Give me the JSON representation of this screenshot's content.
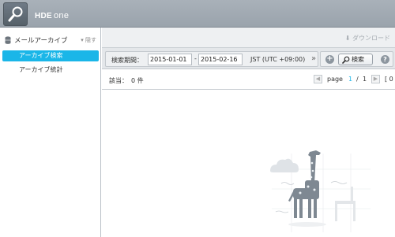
{
  "header": {
    "brand_bold": "HDE",
    "brand_light": "one",
    "logo_icon": "search-icon"
  },
  "sidebar": {
    "section_title": "メールアーカイブ",
    "hide_label": "隠す",
    "items": [
      {
        "label": "アーカイブ検索",
        "active": true
      },
      {
        "label": "アーカイブ統計",
        "active": false
      }
    ]
  },
  "main": {
    "download_label": "ダウンロード",
    "search": {
      "period_label": "検索期間：",
      "date_from": "2015-01-01",
      "separator": "-",
      "date_to": "2015-02-16",
      "timezone": "JST (UTC +09:00)",
      "expand_label": "»",
      "search_button": "検索"
    },
    "result": {
      "count_label": "該当：",
      "count_value": "0 件"
    },
    "pager": {
      "page_label": "page",
      "current": "1",
      "slash": "/",
      "total": "1",
      "trailing": "[ 0"
    }
  },
  "colors": {
    "accent": "#1ab6e8",
    "header": "#9aa3ac"
  }
}
